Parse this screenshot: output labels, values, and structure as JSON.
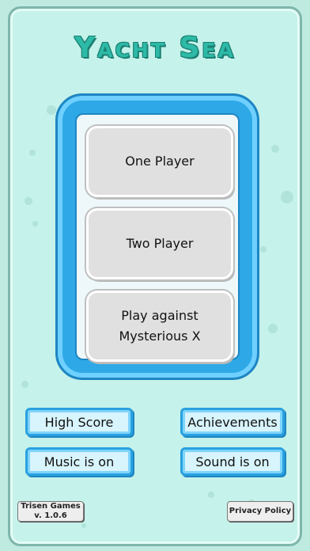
{
  "title": "Yacht Sea",
  "menu": {
    "one_player": "One Player",
    "two_player": "Two Player",
    "play_against": "Play against\nMysterious X"
  },
  "buttons": {
    "high_score": "High Score",
    "achievements": "Achievements",
    "music": "Music is on",
    "sound": "Sound is on"
  },
  "footer": {
    "developer": "Trisen Games",
    "version": "v. 1.0.6",
    "privacy": "Privacy Policy"
  },
  "colors": {
    "background": "#c5f2ea",
    "frame_blue": "#2ea8e6",
    "title_teal": "#2dbaa7"
  }
}
